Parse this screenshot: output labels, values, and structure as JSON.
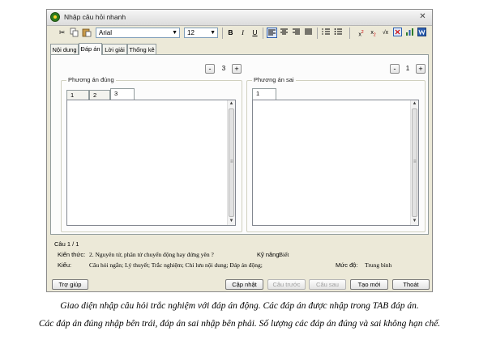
{
  "window": {
    "title": "Nhập câu hỏi nhanh",
    "close_glyph": "✕"
  },
  "toolbar": {
    "font_name": "Arial",
    "font_size": "12",
    "bold": "B",
    "italic": "I",
    "underline": "U"
  },
  "tabs": [
    "Nội dung",
    "Đáp án",
    "Lời giải",
    "Thống kê"
  ],
  "active_tab": "Đáp án",
  "correct": {
    "stepper": {
      "minus": "-",
      "value": "3",
      "plus": "+"
    },
    "group_label": "Phương án đúng",
    "tabs": [
      "1",
      "2",
      "3"
    ],
    "active_tab": "3"
  },
  "wrong": {
    "stepper": {
      "minus": "-",
      "value": "1",
      "plus": "+"
    },
    "group_label": "Phương án sai",
    "tabs": [
      "1"
    ],
    "active_tab": "1"
  },
  "info": {
    "question_counter": "Câu 1 / 1",
    "knowledge_label": "Kiến thức:",
    "knowledge_value": "2. Nguyên tử, phân tử chuyển động hay đứng yên ?",
    "skill_label": "Kỹ năng:",
    "skill_value": "Biết",
    "type_label": "Kiểu:",
    "type_value": "Câu hỏi ngắn; Lý thuyết; Trắc nghiệm; Chỉ lưu nội dung; Đáp án động;",
    "level_label": "Mức độ:",
    "level_value": "Trung bình"
  },
  "buttons": {
    "help": "Trợ giúp",
    "update": "Cập nhật",
    "prev": "Câu trước",
    "next": "Câu sau",
    "new": "Tạo mới",
    "exit": "Thoát"
  },
  "caption": {
    "line1": "Giao diện nhập câu hỏi trắc nghiệm với đáp án động. Các đáp án được nhập trong TAB đáp án.",
    "line2": "Các đáp án đúng nhập bên trái, đáp án sai nhập bên phải. Số lượng các đáp án đúng và sai không hạn chế."
  },
  "colors": {
    "window_bg": "#ece9d8",
    "panel_bg": "#fcfcfc",
    "border": "#919b9c"
  }
}
